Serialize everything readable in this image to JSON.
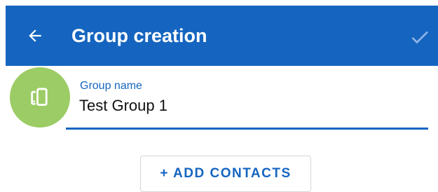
{
  "appbar": {
    "title": "Group creation",
    "back_icon": "arrow-left-icon",
    "confirm_icon": "check-icon",
    "background_color": "#1565c0"
  },
  "avatar": {
    "icon": "devices-icon",
    "background_color": "#9ccc65"
  },
  "group_name_field": {
    "label": "Group name",
    "value": "Test Group 1"
  },
  "add_contacts_button": {
    "label": "+ ADD CONTACTS"
  }
}
